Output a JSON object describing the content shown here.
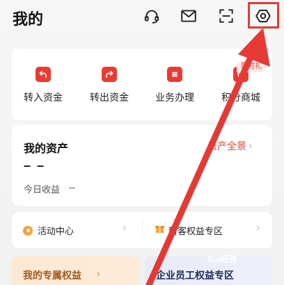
{
  "header": {
    "title": "我的",
    "icons": [
      "headset-icon",
      "mail-icon",
      "scan-icon",
      "settings-icon"
    ]
  },
  "shortcuts": [
    {
      "label": "转入资金",
      "icon": "transfer-in-icon"
    },
    {
      "label": "转出资金",
      "icon": "transfer-out-icon"
    },
    {
      "label": "业务办理",
      "icon": "business-icon"
    },
    {
      "label": "积分商城",
      "icon": "points-mall-icon"
    }
  ],
  "shortcuts_badge": "限时礼",
  "assets": {
    "title": "我的资产",
    "more_label": "资产全景",
    "amount": "– –",
    "today_label": "今日收益",
    "today_value": "--"
  },
  "links": {
    "activity": "活动中心",
    "new_customer": "新客权益专区"
  },
  "banners": {
    "exclusive": "我的专属权益",
    "enterprise": "企业员工权益专区"
  },
  "watermark": "Bai经验",
  "colors": {
    "accent": "#ea3b33",
    "highlight": "#e53935",
    "activity_icon": "#f6a13a"
  }
}
